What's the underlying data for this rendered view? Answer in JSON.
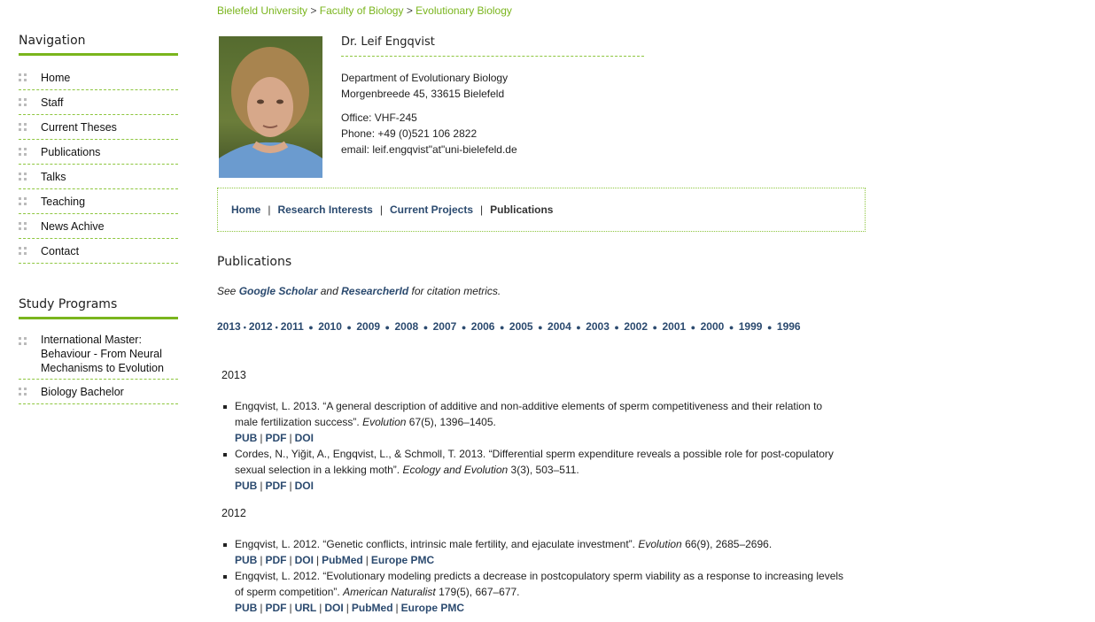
{
  "breadcrumb": {
    "items": [
      "Bielefeld University",
      "Faculty of Biology",
      "Evolutionary Biology"
    ],
    "separator": ">"
  },
  "sidebar": {
    "navigation_title": "Navigation",
    "nav_items": [
      "Home",
      "Staff",
      "Current Theses",
      "Publications",
      "Talks",
      "Teaching",
      "News Achive",
      "Contact"
    ],
    "study_title": "Study Programs",
    "study_items": [
      "International Master: Behaviour - From Neural Mechanisms to Evolution",
      "Biology Bachelor"
    ]
  },
  "profile": {
    "name": "Dr. Leif Engqvist",
    "department": "Department of Evolutionary Biology",
    "address": "Morgenbreede 45, 33615 Bielefeld",
    "office": "Office: VHF-245",
    "phone": "Phone: +49 (0)521 106 2822",
    "email": "email: leif.engqvist\"at\"uni-bielefeld.de"
  },
  "tabs": {
    "home": "Home",
    "research": "Research Interests",
    "projects": "Current Projects",
    "publications": "Publications",
    "separator": "|"
  },
  "section": {
    "title": "Publications",
    "see": "See",
    "google_scholar": "Google Scholar",
    "and": "and",
    "researcherid": "ResearcherId",
    "for_citation": "for citation metrics."
  },
  "years": [
    "2013",
    "2012",
    "2011",
    "2010",
    "2009",
    "2008",
    "2007",
    "2006",
    "2005",
    "2004",
    "2003",
    "2002",
    "2001",
    "2000",
    "1999",
    "1996"
  ],
  "groups": [
    {
      "year": "2013",
      "pubs": [
        {
          "authors": "Engqvist, L. 2013.",
          "title": "“A general description of additive and non-additive elements of sperm competitiveness and their relation to male fertilization success”.",
          "journal": "Evolution",
          "rest": "67(5), 1396–1405.",
          "links": [
            "PUB",
            "PDF",
            "DOI"
          ]
        },
        {
          "authors": "Cordes, N., Yiğit, A., Engqvist, L., & Schmoll, T. 2013.",
          "title": "“Differential sperm expenditure reveals a possible role for post-copulatory sexual selection in a lekking moth”.",
          "journal": "Ecology and Evolution",
          "rest": "3(3), 503–511.",
          "links": [
            "PUB",
            "PDF",
            "DOI"
          ]
        }
      ]
    },
    {
      "year": "2012",
      "pubs": [
        {
          "authors": "Engqvist, L. 2012.",
          "title": "“Genetic conflicts, intrinsic male fertility, and ejaculate investment”.",
          "journal": "Evolution",
          "rest": "66(9), 2685–2696.",
          "links": [
            "PUB",
            "PDF",
            "DOI",
            "PubMed",
            "Europe PMC"
          ]
        },
        {
          "authors": "Engqvist, L. 2012.",
          "title": "“Evolutionary modeling predicts a decrease in postcopulatory sperm viability as a response to increasing levels of sperm competition”.",
          "journal": "American Naturalist",
          "rest": "179(5), 667–677.",
          "links": [
            "PUB",
            "PDF",
            "URL",
            "DOI",
            "PubMed",
            "Europe PMC"
          ]
        }
      ]
    }
  ],
  "colors": {
    "green": "#7ab51d",
    "link_blue": "#2b4a6f"
  }
}
